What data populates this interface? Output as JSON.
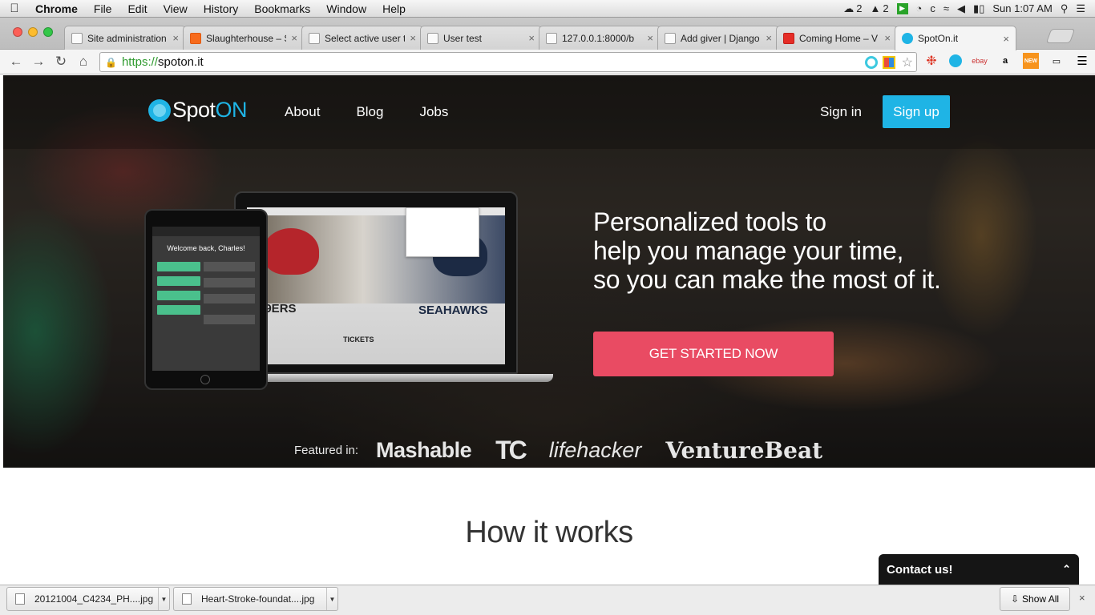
{
  "menubar": {
    "app": "Chrome",
    "items": [
      "File",
      "Edit",
      "View",
      "History",
      "Bookmarks",
      "Window",
      "Help"
    ],
    "status": {
      "cloud_count": "2",
      "adobe_count": "2",
      "clock": "Sun 1:07 AM"
    }
  },
  "tabs": [
    {
      "title": "Site administration",
      "icon": "page"
    },
    {
      "title": "Slaughterhouse – S",
      "icon": "soundcloud"
    },
    {
      "title": "Select active user t",
      "icon": "page"
    },
    {
      "title": "User test",
      "icon": "page"
    },
    {
      "title": "127.0.0.1:8000/b",
      "icon": "page"
    },
    {
      "title": "Add giver | Django",
      "icon": "page"
    },
    {
      "title": "Coming Home – V",
      "icon": "youtube"
    },
    {
      "title": "SpotOn.it",
      "icon": "spoton",
      "active": true
    }
  ],
  "address": {
    "scheme": "https://",
    "host": "spoton.it"
  },
  "site": {
    "logo_spot": "Spot",
    "logo_on": "ON",
    "nav": [
      "About",
      "Blog",
      "Jobs"
    ],
    "signin": "Sign in",
    "signup": "Sign up",
    "headline": [
      "Personalized tools to",
      "help you manage your time,",
      "so you can make the most of it."
    ],
    "cta": "GET STARTED NOW",
    "featured_label": "Featured in:",
    "featured": [
      "Mashable",
      "TC",
      "lifehacker",
      "VentureBeat"
    ],
    "tablet_welcome": "Welcome back, Charles!",
    "laptop_team_left": "49ERS",
    "laptop_team_right": "SEAHAWKS",
    "laptop_tickets": "TICKETS",
    "how_title": "How it works",
    "contact": "Contact us!"
  },
  "downloads": {
    "files": [
      "20121004_C4234_PH....jpg",
      "Heart-Stroke-foundat....jpg"
    ],
    "show_all": "Show All"
  },
  "colors": {
    "brand_blue": "#1fb4e5",
    "cta_pink": "#e94b63"
  }
}
